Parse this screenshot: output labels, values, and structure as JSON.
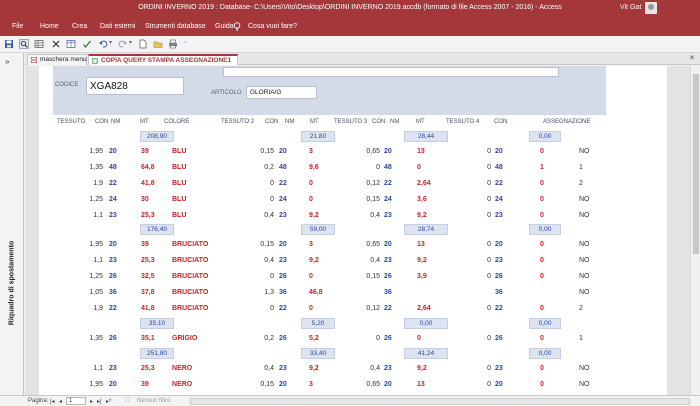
{
  "window": {
    "title": "ORDINI INVERNO 2019 : Database- C:\\Users\\Vito\\Desktop\\ORDINI INVERNO 2019.accdb (formato di file Access 2007 - 2016) - Access",
    "user": "Vit Gat"
  },
  "ribbon": {
    "tabs": [
      "File",
      "Home",
      "Crea",
      "Dati esterni",
      "Strumenti database",
      "Guida",
      "Cosa vuoi fare?"
    ]
  },
  "nav_pane": {
    "label": "Riquadro di spostamento",
    "chevron": "»"
  },
  "doc_tabs": [
    {
      "label": "maschera menu",
      "icon": "form-icon"
    },
    {
      "label": "COPIA QUERY STAMPA ASSEGNAZIONE1",
      "icon": "report-icon"
    }
  ],
  "report": {
    "codice_label": "CODICE",
    "codice_value": "XGA828",
    "articolo_label": "ARTICOLO",
    "articolo_value": "GLORIA/G",
    "columns": [
      "TESSUTO",
      "CON",
      "NM",
      "MT",
      "COLORE",
      "TESSUTO 2",
      "CON",
      "NM",
      "MT",
      "TESSUTO 3",
      "CON",
      "NM",
      "MT",
      "TESSUTO 4",
      "CON",
      "ASSEGNAZIONE"
    ],
    "blocks": [
      {
        "subtotals": [
          "208,90",
          "21,80",
          "28,44",
          "0,00"
        ],
        "rows": [
          [
            "1,95",
            "20",
            "39",
            "BLU",
            "0,15",
            "20",
            "3",
            "0,65",
            "20",
            "13",
            "0",
            "20",
            "0",
            "NO"
          ],
          [
            "1,35",
            "48",
            "64,8",
            "BLU",
            "0,2",
            "48",
            "9,6",
            "0",
            "48",
            "0",
            "0",
            "48",
            "1",
            "1"
          ],
          [
            "1,9",
            "22",
            "41,8",
            "BLU",
            "0",
            "22",
            "0",
            "0,12",
            "22",
            "2,64",
            "0",
            "22",
            "0",
            "2"
          ],
          [
            "1,25",
            "24",
            "30",
            "BLU",
            "0",
            "24",
            "0",
            "0,15",
            "24",
            "3,6",
            "0",
            "24",
            "0",
            "NO"
          ],
          [
            "1,1",
            "23",
            "25,3",
            "BLU",
            "0,4",
            "23",
            "9,2",
            "0,4",
            "23",
            "9,2",
            "0",
            "23",
            "0",
            "NO"
          ]
        ]
      },
      {
        "subtotals": [
          "176,40",
          "59,00",
          "28,74",
          "0,00"
        ],
        "rows": [
          [
            "1,95",
            "20",
            "39",
            "BRUCIATO",
            "0,15",
            "20",
            "3",
            "0,65",
            "20",
            "13",
            "0",
            "20",
            "0",
            "NO"
          ],
          [
            "1,1",
            "23",
            "25,3",
            "BRUCIATO",
            "0,4",
            "23",
            "9,2",
            "0,4",
            "23",
            "9,2",
            "0",
            "23",
            "0",
            "NO"
          ],
          [
            "1,25",
            "26",
            "32,5",
            "BRUCIATO",
            "0",
            "26",
            "0",
            "0,15",
            "26",
            "3,9",
            "0",
            "26",
            "0",
            "NO"
          ],
          [
            "1,05",
            "36",
            "37,8",
            "BRUCIATO",
            "1,3",
            "36",
            "46,8",
            "",
            "36",
            "",
            "",
            "36",
            "",
            "NO"
          ],
          [
            "1,9",
            "22",
            "41,8",
            "BRUCIATO",
            "0",
            "22",
            "0",
            "0,12",
            "22",
            "2,64",
            "0",
            "22",
            "0",
            "2"
          ]
        ]
      },
      {
        "subtotals": [
          "35,10",
          "5,20",
          "0,00",
          "0,00"
        ],
        "rows": [
          [
            "1,35",
            "26",
            "35,1",
            "GRIGIO",
            "0,2",
            "26",
            "5,2",
            "0",
            "26",
            "0",
            "0",
            "26",
            "0",
            "1"
          ]
        ]
      },
      {
        "subtotals": [
          "251,80",
          "33,40",
          "41,24",
          "0,00"
        ],
        "rows": [
          [
            "1,1",
            "23",
            "25,3",
            "NERO",
            "0,4",
            "23",
            "9,2",
            "0,4",
            "23",
            "9,2",
            "0",
            "23",
            "0",
            "NO"
          ],
          [
            "1,95",
            "20",
            "39",
            "NERO",
            "0,15",
            "20",
            "3",
            "0,65",
            "20",
            "13",
            "0",
            "20",
            "0",
            "NO"
          ]
        ]
      }
    ]
  },
  "status_bar": {
    "pagina_label": "Pagina:",
    "page_value": "1",
    "filter_label": "Nessun filtro"
  },
  "colors": {
    "accent": "#a4373a",
    "value_blue": "#2848a4",
    "value_red": "#d02020",
    "header_band": "#d5dae8"
  }
}
